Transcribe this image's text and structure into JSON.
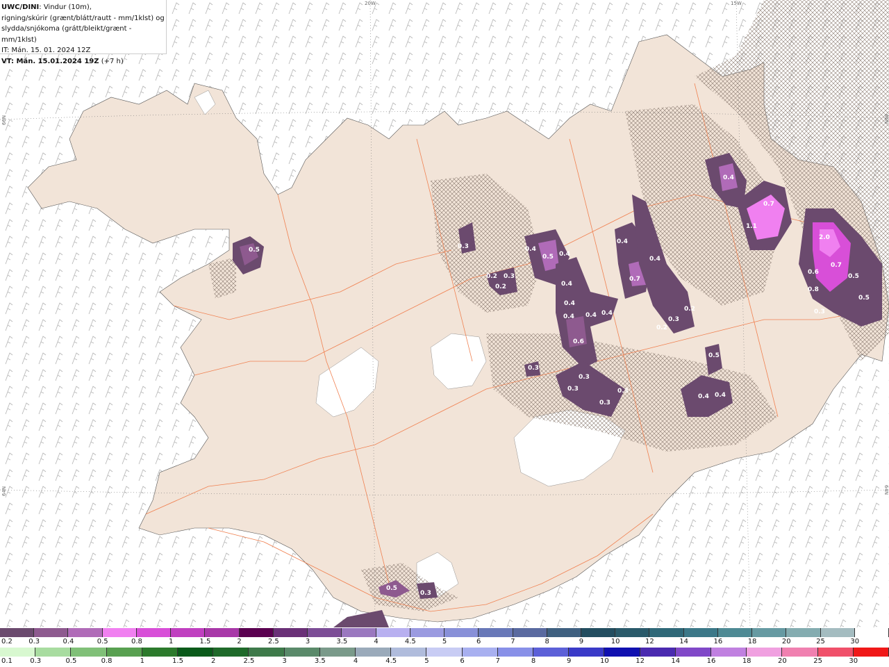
{
  "title": {
    "model": "UWC/DINI",
    "line1_rest": ": Vindur (10m),",
    "line2": "rigning/skúrir (grænt/blátt/rautt - mm/1klst) og",
    "line3": "slydda/snjókoma (grátt/bleikt/grænt - mm/1klst)",
    "line4": "IT: Mán. 15. 01. 2024 12Z",
    "line5_bold": "VT: Mán. 15.01.2024 19Z",
    "line5_rest": " (+7 h)"
  },
  "graticule": {
    "top_20w": "20W",
    "top_15w": "15W",
    "left_66n": "66N",
    "left_64n": "64N",
    "right_66n": "66N",
    "right_64n": "64N"
  },
  "precip_values": [
    "0.5",
    "0.3",
    "0.4",
    "0.5",
    "0.4",
    "0.2",
    "0.3",
    "0.2",
    "0.4",
    "0.4",
    "0.4",
    "0.4",
    "0.4",
    "0.6",
    "0.3",
    "0.3",
    "0.3",
    "0.3",
    "0.3",
    "0.4",
    "0.4",
    "0.7",
    "0.2",
    "0.3",
    "0.2",
    "0.5",
    "0.4",
    "0.4",
    "0.4",
    "0.7",
    "1.1",
    "2.0",
    "0.6",
    "0.7",
    "0.8",
    "0.5",
    "0.5",
    "0.3",
    "0.5",
    "0.3"
  ],
  "legend_snow": {
    "labels": [
      "0.2",
      "0.3",
      "0.4",
      "0.5",
      "0.8",
      "1",
      "1.5",
      "2",
      "2.5",
      "3",
      "3.5",
      "4",
      "4.5",
      "5",
      "6",
      "7",
      "8",
      "9",
      "10",
      "12",
      "14",
      "16",
      "18",
      "20",
      "25",
      "30"
    ],
    "colors": [
      "#6b4a6e",
      "#8e5a8f",
      "#b06bb8",
      "#f080f0",
      "#d84fd8",
      "#c040c0",
      "#a838a8",
      "#5a0050",
      "#6a3077",
      "#7c4d96",
      "#9a78bf",
      "#b8b0f0",
      "#9a9ae0",
      "#8890d8",
      "#6878b8",
      "#5a6aa0",
      "#3f6080",
      "#234e60",
      "#2a5a6a",
      "#2f6878",
      "#3c7888",
      "#4e8a94",
      "#669aa2",
      "#84acb0",
      "#a4bcc0",
      "#ffffff"
    ]
  },
  "legend_rain": {
    "labels": [
      "0.1",
      "0.3",
      "0.5",
      "0.8",
      "1",
      "1.5",
      "2",
      "2.5",
      "3",
      "3.5",
      "4",
      "4.5",
      "5",
      "6",
      "7",
      "8",
      "9",
      "10",
      "12",
      "14",
      "16",
      "18",
      "20",
      "25",
      "30"
    ],
    "colors": [
      "#d8f8d0",
      "#a8dca0",
      "#80c078",
      "#58a050",
      "#2c7a2c",
      "#0a5a1a",
      "#1f6a2a",
      "#3e7a4a",
      "#5a8a6a",
      "#7a9a8a",
      "#9aaaba",
      "#b0bcdc",
      "#c8ccf4",
      "#a8b0f0",
      "#8890e8",
      "#5c60d8",
      "#3a3ac8",
      "#1010b0",
      "#4a2ab0",
      "#8048c8",
      "#c080e0",
      "#f0a0e0",
      "#f080b0",
      "#f0506a",
      "#f01818"
    ]
  }
}
